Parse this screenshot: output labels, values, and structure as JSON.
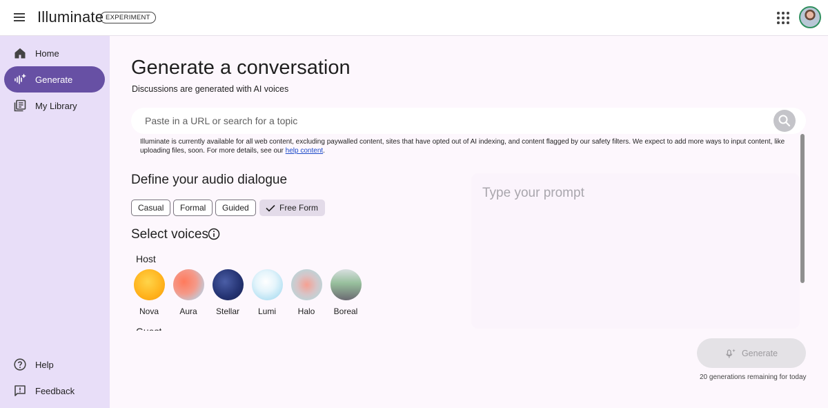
{
  "header": {
    "app_title": "Illuminate",
    "badge": "EXPERIMENT"
  },
  "sidebar": {
    "items": [
      {
        "label": "Home",
        "icon": "home-icon"
      },
      {
        "label": "Generate",
        "icon": "sparkle-waveform-icon",
        "active": true
      },
      {
        "label": "My Library",
        "icon": "library-icon"
      }
    ],
    "bottom_items": [
      {
        "label": "Help",
        "icon": "help-icon"
      },
      {
        "label": "Feedback",
        "icon": "feedback-icon"
      }
    ]
  },
  "main": {
    "title": "Generate a conversation",
    "subtitle": "Discussions are generated with AI voices",
    "search": {
      "placeholder": "Paste in a URL or search for a topic",
      "value": ""
    },
    "notice": {
      "text": "Illuminate is currently available for all web content, excluding paywalled content, sites that have opted out of AI indexing, and content flagged by our safety filters. We expect to add more ways to input content, like uploading files, soon. For more details, see our ",
      "link": "help content",
      "end": "."
    },
    "dialogue": {
      "heading": "Define your audio dialogue",
      "styles": [
        "Casual",
        "Formal",
        "Guided",
        "Free Form"
      ],
      "selected_style": "Free Form"
    },
    "voices": {
      "heading": "Select voices",
      "host_label": "Host",
      "hosts": [
        "Nova",
        "Aura",
        "Stellar",
        "Lumi",
        "Halo",
        "Boreal"
      ],
      "guest_label": "Guest"
    },
    "prompt": {
      "placeholder": "Type your prompt",
      "value": ""
    },
    "generate_button": "Generate",
    "remaining": "20 generations remaining for today"
  },
  "colors": {
    "accent": "#6750a4",
    "sidebar_bg": "#e8def8",
    "page_bg": "#fdf7fd"
  }
}
